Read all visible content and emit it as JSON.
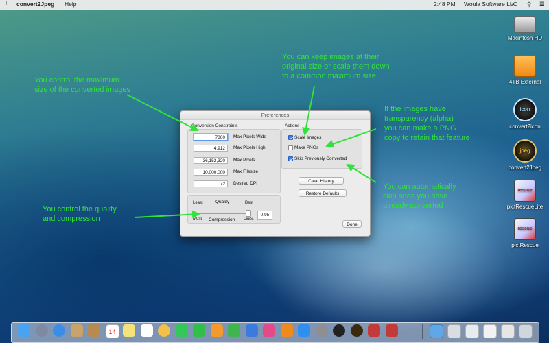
{
  "menubar": {
    "apple_icon": "apple-icon",
    "app_name": "convert2Jpeg",
    "help": "Help",
    "clock": "2:48 PM",
    "user": "Woula Software LLC"
  },
  "desktop_icons": [
    {
      "label": "Macintosh HD",
      "icon": "hard-drive-icon"
    },
    {
      "label": "4TB External",
      "icon": "external-drive-icon"
    },
    {
      "label": "convert2icon",
      "icon": "convert2icon-app-icon",
      "glyph": "icon"
    },
    {
      "label": "convert2Jpeg",
      "icon": "convert2jpeg-app-icon",
      "glyph": "jpeg"
    },
    {
      "label": "pictRescueLite",
      "icon": "pictrescuelite-app-icon",
      "glyph": "rescue"
    },
    {
      "label": "pictRescue",
      "icon": "pictrescue-app-icon",
      "glyph": "rescue"
    }
  ],
  "dialog": {
    "title": "Preferences",
    "constraints": {
      "section_label": "Conversion Constraints",
      "fields": [
        {
          "value": "7360",
          "label": "Max Pixels Wide"
        },
        {
          "value": "4,912",
          "label": "Max Pixels High"
        },
        {
          "value": "36,152,320",
          "label": "Max Pixels"
        },
        {
          "value": "10,000,000",
          "label": "Max Filesize"
        },
        {
          "value": "72",
          "label": "Desired DPI"
        }
      ],
      "quality": {
        "least_top": "Least",
        "quality": "Quality",
        "best": "Best",
        "most": "Most",
        "compression": "Compression",
        "least_bottom": "Least",
        "value": "0.95",
        "slider_fraction": 0.95
      }
    },
    "actions": {
      "section_label": "Actions",
      "checkboxes": [
        {
          "label": "Scale Images",
          "checked": true
        },
        {
          "label": "Make PNGs",
          "checked": false
        },
        {
          "label": "Skip Previously Converted",
          "checked": true
        }
      ],
      "clear_history": "Clear History",
      "restore_defaults": "Restore Defaults"
    },
    "done": "Done"
  },
  "annotations": {
    "max_size": [
      "You control the maximum",
      "size of the converted images"
    ],
    "scale": [
      "You can keep images at their",
      "original size or scale them down",
      "to a common maximum size"
    ],
    "png": [
      "If the images have",
      "transparency (alpha)",
      "you can make a PNG",
      "copy to retain that feature"
    ],
    "skip": [
      "You can automatically",
      "skip ones you have",
      "already converted"
    ],
    "quality": [
      "You control the quality",
      "and compression"
    ],
    "color": "#30e23a"
  },
  "dock": {
    "items": [
      "finder-icon",
      "launchpad-icon",
      "safari-icon",
      "mail-stamp-icon",
      "contacts-icon",
      "calendar-icon",
      "notes-icon",
      "reminders-icon",
      "photos-icon",
      "messages-icon",
      "facetime-icon",
      "pages-icon",
      "numbers-icon",
      "keynote-icon",
      "itunes-icon",
      "ibooks-icon",
      "app-store-icon",
      "system-preferences-icon",
      "convert2icon-dock-icon",
      "convert2jpeg-dock-icon",
      "pictrescue-dock-icon",
      "pictrescuelite-dock-icon"
    ],
    "calendar_day": "14",
    "right_items": [
      "applications-folder-icon",
      "documents-icon",
      "downloads-icon",
      "stack-icon",
      "stack-icon-2",
      "trash-icon"
    ]
  }
}
